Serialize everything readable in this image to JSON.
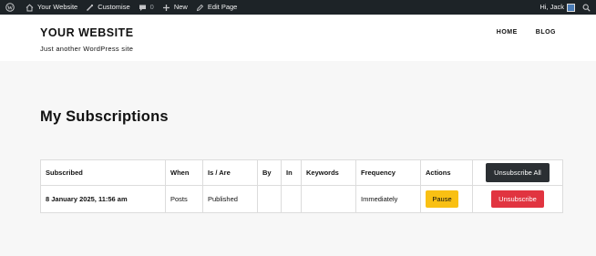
{
  "adminbar": {
    "site_name": "Your Website",
    "customise": "Customise",
    "comments_count": "0",
    "new": "New",
    "edit_page": "Edit Page",
    "greeting": "Hi, Jack"
  },
  "header": {
    "site_title": "YOUR WEBSITE",
    "tagline": "Just another WordPress site",
    "nav": [
      "HOME",
      "BLOG"
    ]
  },
  "main": {
    "title": "My Subscriptions",
    "table": {
      "headers": {
        "subscribed": "Subscribed",
        "when": "When",
        "is_are": "Is / Are",
        "by": "By",
        "in": "In",
        "keywords": "Keywords",
        "frequency": "Frequency",
        "actions": "Actions"
      },
      "unsubscribe_all_label": "Unsubscribe All",
      "rows": [
        {
          "subscribed": "8 January 2025, 11:56 am",
          "when": "Posts",
          "is_are": "Published",
          "by": "",
          "in": "",
          "keywords": "",
          "frequency": "Immediately",
          "pause_label": "Pause",
          "unsubscribe_label": "Unsubscribe"
        }
      ]
    }
  },
  "colors": {
    "adminbar_bg": "#1d2327",
    "pause_button": "#f9c013",
    "unsubscribe_button": "#e13440",
    "unsubscribe_all_button": "#2b2f33"
  },
  "icons": [
    "wordpress-icon",
    "home-icon",
    "brush-icon",
    "comment-icon",
    "plus-icon",
    "pencil-icon",
    "search-icon"
  ]
}
